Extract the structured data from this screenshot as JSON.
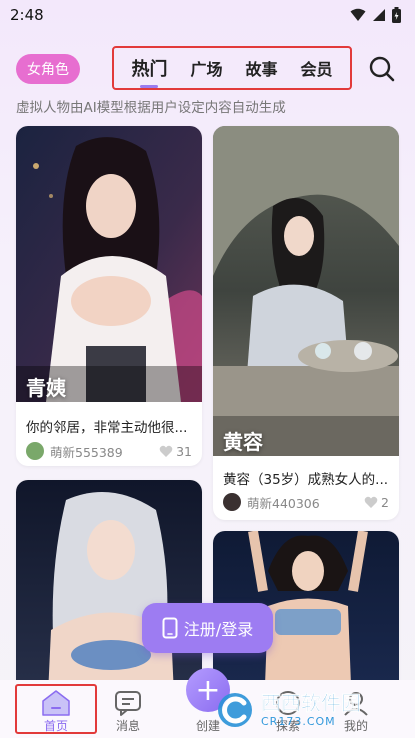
{
  "status_bar": {
    "time": "2:48"
  },
  "header": {
    "gender_label": "女角色",
    "tabs": [
      {
        "label": "热门",
        "active": true
      },
      {
        "label": "广场",
        "active": false
      },
      {
        "label": "故事",
        "active": false
      },
      {
        "label": "会员",
        "active": false
      }
    ],
    "search_icon": "search-icon"
  },
  "subtitle": "虚拟人物由AI模型根据用户设定内容自动生成",
  "cards": [
    {
      "name": "青姨",
      "desc": "你的邻居，非常主动他很...",
      "user": "萌新555389",
      "likes": "31"
    },
    {
      "name": "黄容",
      "desc": "黄容（35岁）成熟女人的...",
      "user": "萌新440306",
      "likes": "2"
    },
    {
      "name": "",
      "desc": "",
      "user": "",
      "likes": ""
    },
    {
      "name": "",
      "desc": "",
      "user": "",
      "likes": ""
    }
  ],
  "login_button": "注册/登录",
  "bottom_nav": {
    "items": [
      {
        "label": "首页",
        "icon": "home-icon",
        "active": true
      },
      {
        "label": "消息",
        "icon": "message-icon",
        "active": false
      },
      {
        "label": "创建",
        "icon": "plus-icon",
        "active": false
      },
      {
        "label": "探索",
        "icon": "explore-icon",
        "active": false
      },
      {
        "label": "我的",
        "icon": "profile-icon",
        "active": false
      }
    ]
  },
  "watermark": {
    "brand": "西西软件园",
    "url": "CR173.COM"
  },
  "colors": {
    "accent": "#9d7cf2",
    "pink": "#e76ed0",
    "highlight_box": "#e23a3a"
  }
}
